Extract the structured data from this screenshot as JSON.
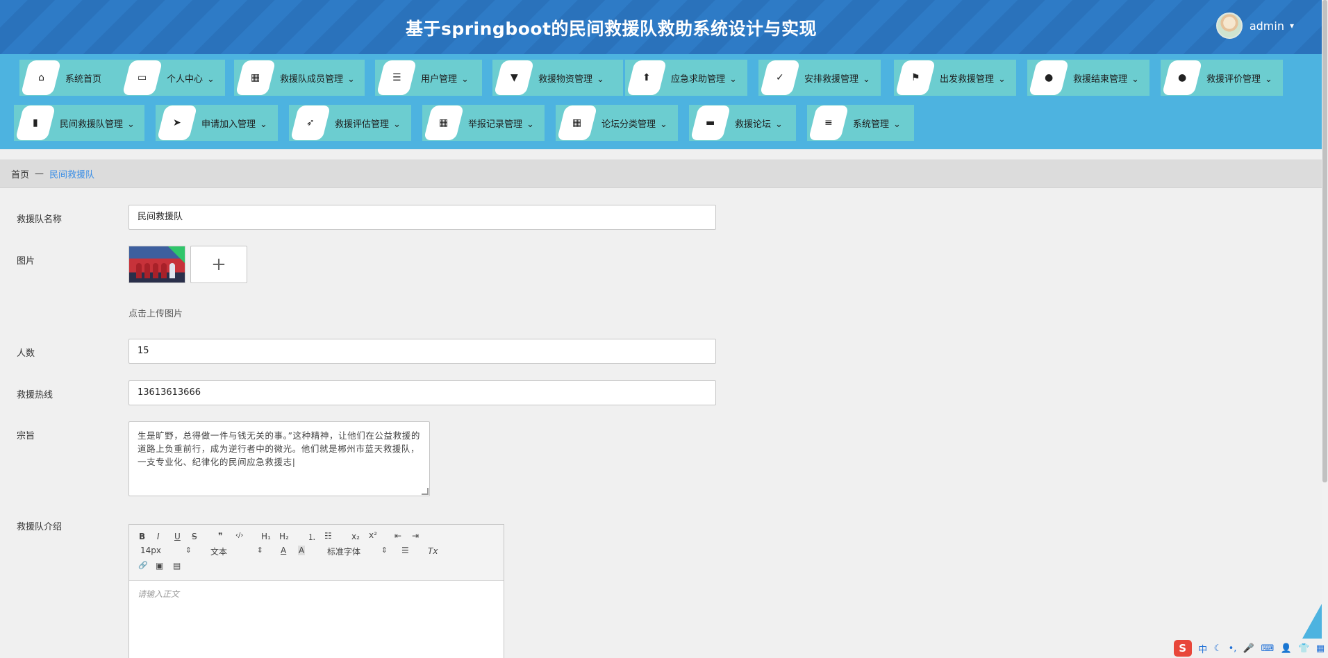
{
  "header": {
    "title": "基于springboot的民间救援队救助系统设计与实现",
    "username": "admin",
    "caret": "▾"
  },
  "nav": {
    "items": [
      {
        "label": "系统首页",
        "icon": "⌂",
        "name": "home",
        "arrow": ""
      },
      {
        "label": "个人中心",
        "icon": "▭",
        "name": "personal-center",
        "arrow": "⌄"
      },
      {
        "label": "救援队成员管理",
        "icon": "▦",
        "name": "member-management",
        "arrow": "⌄"
      },
      {
        "label": "用户管理",
        "icon": "☰",
        "name": "user-management",
        "arrow": "⌄"
      },
      {
        "label": "救援物资管理",
        "icon": "▼",
        "name": "supplies-management",
        "arrow": "⌄"
      },
      {
        "label": "应急求助管理",
        "icon": "⬆",
        "name": "emergency-management",
        "arrow": "⌄"
      },
      {
        "label": "安排救援管理",
        "icon": "✓",
        "name": "arrange-management",
        "arrow": "⌄"
      },
      {
        "label": "出发救援管理",
        "icon": "⚑",
        "name": "departure-management",
        "arrow": "⌄"
      },
      {
        "label": "救援结束管理",
        "icon": "●",
        "name": "end-management",
        "arrow": "⌄"
      },
      {
        "label": "救援评价管理",
        "icon": "●",
        "name": "review-management",
        "arrow": "⌄"
      },
      {
        "label": "民间救援队管理",
        "icon": "▮",
        "name": "team-management",
        "arrow": "⌄"
      },
      {
        "label": "申请加入管理",
        "icon": "➤",
        "name": "join-management",
        "arrow": "⌄"
      },
      {
        "label": "救援评估管理",
        "icon": "➶",
        "name": "assessment-management",
        "arrow": "⌄"
      },
      {
        "label": "举报记录管理",
        "icon": "▦",
        "name": "report-management",
        "arrow": "⌄"
      },
      {
        "label": "论坛分类管理",
        "icon": "▦",
        "name": "forum-category-management",
        "arrow": "⌄"
      },
      {
        "label": "救援论坛",
        "icon": "▬",
        "name": "forum",
        "arrow": "⌄"
      },
      {
        "label": "系统管理",
        "icon": "≡",
        "name": "system-management",
        "arrow": "⌄"
      }
    ]
  },
  "breadcrumb": {
    "home": "首页",
    "separator": "—",
    "current": "民间救援队"
  },
  "form": {
    "name_label": "救援队名称",
    "name_value": "民间救援队",
    "image_label": "图片",
    "upload_plus": "+",
    "upload_hint": "点击上传图片",
    "count_label": "人数",
    "count_value": "15",
    "hotline_label": "救援热线",
    "hotline_value": "13613613666",
    "purpose_label": "宗旨",
    "purpose_value": "生是旷野，总得做一件与钱无关的事。”这种精神，让他们在公益救援的道路上负重前行，成为逆行者中的微光。他们就是郴州市蓝天救援队，一支专业化、纪律化的民间应急救援志|",
    "intro_label": "救援队介绍",
    "editor_placeholder": "请输入正文"
  },
  "editor_toolbar": {
    "bold": "B",
    "italic": "I",
    "underline": "U",
    "strike": "S",
    "quote": "❞",
    "code": "‹/›",
    "h1": "H₁",
    "h2": "H₂",
    "ordered": "⒈",
    "bullet": "☷",
    "sub": "x₂",
    "sup": "x²",
    "outdent": "⇤",
    "indent": "⇥",
    "size": "14px",
    "format": "文本",
    "font": "标准字体",
    "color": "A",
    "bg": "A",
    "align": "☰",
    "clear": "Tx",
    "link": "🔗",
    "image": "▣",
    "video": "▤"
  },
  "ime": {
    "logo": "S",
    "lang": "中",
    "moon": "☾",
    "punct": "•,",
    "mic": "🎤",
    "keyboard": "⌨",
    "user": "👤",
    "shirt": "👕",
    "grid": "▦"
  }
}
